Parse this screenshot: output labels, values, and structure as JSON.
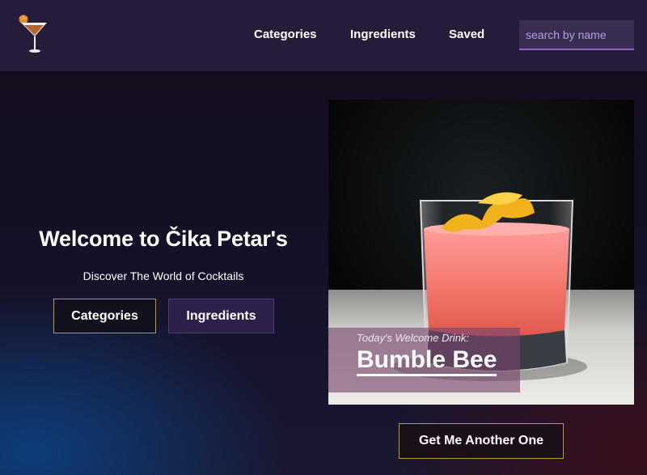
{
  "nav": {
    "logo_icon": "cocktail-glass-icon",
    "links": [
      "Categories",
      "Ingredients",
      "Saved"
    ],
    "search_placeholder": "search by name"
  },
  "hero": {
    "title": "Welcome to Čika Petar's",
    "subtitle": "Discover The World of Cocktails",
    "buttons": [
      "Categories",
      "Ingredients"
    ]
  },
  "drink": {
    "label": "Today's Welcome Drink:",
    "name": "Bumble Bee",
    "another_button": "Get Me Another One"
  },
  "colors": {
    "navbar": "#261b39",
    "accent_border": "#b79a32",
    "search_underline": "#8a63d2"
  }
}
